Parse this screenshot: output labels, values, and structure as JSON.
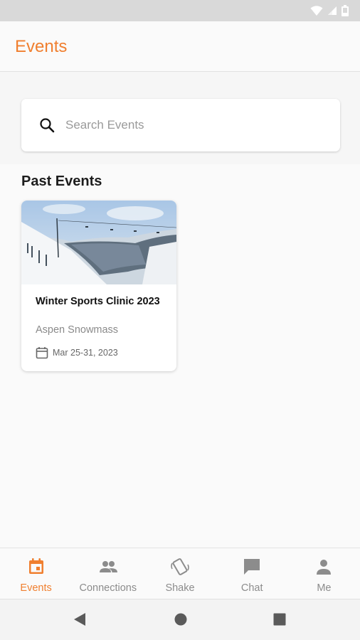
{
  "app": {
    "title": "Events"
  },
  "colors": {
    "accent": "#f07f2f",
    "inactive": "#8c8c8c"
  },
  "search": {
    "placeholder": "Search Events",
    "value": ""
  },
  "section": {
    "title": "Past Events"
  },
  "events": [
    {
      "title": "Winter Sports Clinic 2023",
      "location": "Aspen Snowmass",
      "date": "Mar 25-31, 2023",
      "image": "snowy-ski-slope-photo"
    }
  ],
  "nav": {
    "items": [
      {
        "label": "Events",
        "icon": "calendar-icon",
        "active": true
      },
      {
        "label": "Connections",
        "icon": "people-icon",
        "active": false
      },
      {
        "label": "Shake",
        "icon": "shake-phone-icon",
        "active": false
      },
      {
        "label": "Chat",
        "icon": "chat-icon",
        "active": false
      },
      {
        "label": "Me",
        "icon": "person-icon",
        "active": false
      }
    ]
  },
  "system_nav": {
    "icons": [
      "back-icon",
      "home-icon",
      "recents-icon"
    ]
  },
  "status_bar": {
    "icons": [
      "wifi-icon",
      "signal-icon",
      "battery-icon"
    ]
  }
}
